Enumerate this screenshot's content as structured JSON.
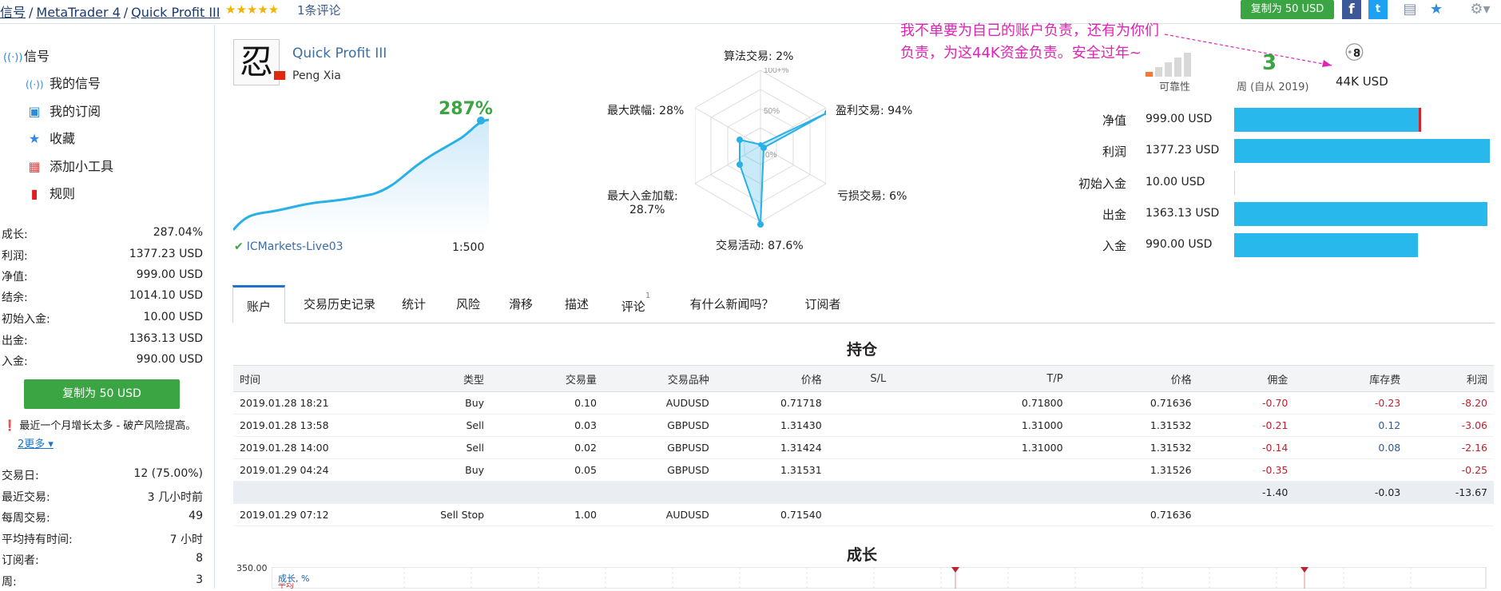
{
  "header": {
    "breadcrumb": [
      "信号",
      "MetaTrader 4",
      "Quick Profit III"
    ],
    "stars": "★★★★★",
    "review_count": "1条评论",
    "copy_button": "复制为 50 USD",
    "icons": [
      "facebook-icon",
      "twitter-icon",
      "document-icon",
      "favorite-star-icon",
      "settings-gear-icon"
    ]
  },
  "sidebar": {
    "section_title": "信号",
    "items": [
      {
        "label": "我的信号",
        "icon": "signal-icon"
      },
      {
        "label": "我的订阅",
        "icon": "subscription-icon"
      },
      {
        "label": "收藏",
        "icon": "star-icon"
      },
      {
        "label": "添加小工具",
        "icon": "widgets-icon"
      },
      {
        "label": "规则",
        "icon": "bookmark-icon"
      }
    ],
    "stats": [
      {
        "k": "成长:",
        "v": "287.04%"
      },
      {
        "k": "利润:",
        "v": "1377.23 USD"
      },
      {
        "k": "净值:",
        "v": "999.00 USD"
      },
      {
        "k": "结余:",
        "v": "1014.10 USD"
      },
      {
        "k": "初始入金:",
        "v": "10.00 USD"
      },
      {
        "k": "出金:",
        "v": "1363.13 USD"
      },
      {
        "k": "入金:",
        "v": "990.00 USD"
      }
    ],
    "copy_button": "复制为 50 USD",
    "warning": "最近一个月增长太多 - 破产风险提高。",
    "more_link": "2更多 ▾",
    "stats2": [
      {
        "k": "交易日:",
        "v": "12 (75.00%)"
      },
      {
        "k": "最近交易:",
        "v": "3 几小时前"
      },
      {
        "k": "每周交易:",
        "v": "49"
      },
      {
        "k": "平均持有时间:",
        "v": "7 小时"
      },
      {
        "k": "订阅者:",
        "v": "8"
      },
      {
        "k": "周:",
        "v": "3"
      }
    ]
  },
  "profile": {
    "name": "Quick Profit III",
    "author": "Peng Xia",
    "avatar_glyph": "忍",
    "growth": "287%",
    "broker": "ICMarkets-Live03",
    "leverage": "1:500"
  },
  "radar": {
    "labels": {
      "algo": "算法交易: 2%",
      "profit_trades": "盈利交易: 94%",
      "loss_trades": "亏损交易: 6%",
      "activity": "交易活动: 87.6%",
      "max_load": "最大入金加载:",
      "max_load_val": "28.7%",
      "max_dd": "最大跌幅: 28%"
    },
    "scale": [
      "100+%",
      "50%",
      "0%"
    ]
  },
  "annotation": "我不单要为自己的账户负责，还有为你们负责，为这44K资金负责。安全过年~",
  "summary": {
    "reliability_label": "可靠性",
    "weeks_value": "3",
    "weeks_label": "周 (自从 2019)",
    "subscribers": "8",
    "funds": "44K USD"
  },
  "bars": [
    {
      "k": "净值",
      "v": "999.00 USD",
      "fraction": 0.72,
      "marker": true
    },
    {
      "k": "利润",
      "v": "1377.23 USD",
      "fraction": 1.0
    },
    {
      "k": "初始入金",
      "v": "10.00 USD",
      "fraction": 0.0
    },
    {
      "k": "出金",
      "v": "1363.13 USD",
      "fraction": 0.99
    },
    {
      "k": "入金",
      "v": "990.00 USD",
      "fraction": 0.72
    }
  ],
  "tabs": [
    "账户",
    "交易历史记录",
    "统计",
    "风险",
    "滑移",
    "描述",
    "评论",
    "有什么新闻吗？",
    "订阅者"
  ],
  "review_badge": "1",
  "positions": {
    "title": "持仓",
    "headers": [
      "时间",
      "类型",
      "交易量",
      "交易品种",
      "价格",
      "S/L",
      "T/P",
      "价格",
      "佣金",
      "库存费",
      "利润"
    ],
    "rows": [
      [
        "2019.01.28 18:21",
        "Buy",
        "0.10",
        "AUDUSD",
        "0.71718",
        "",
        "0.71800",
        "0.71636",
        "-0.70",
        "-0.23",
        "-8.20"
      ],
      [
        "2019.01.28 13:58",
        "Sell",
        "0.03",
        "GBPUSD",
        "1.31430",
        "",
        "1.31000",
        "1.31532",
        "-0.21",
        "0.12",
        "-3.06"
      ],
      [
        "2019.01.28 14:00",
        "Sell",
        "0.02",
        "GBPUSD",
        "1.31424",
        "",
        "1.31000",
        "1.31532",
        "-0.14",
        "0.08",
        "-2.16"
      ],
      [
        "2019.01.29 04:24",
        "Buy",
        "0.05",
        "GBPUSD",
        "1.31531",
        "",
        "",
        "1.31526",
        "-0.35",
        "",
        "-0.25"
      ]
    ],
    "totals": [
      "",
      "",
      "",
      "",
      "",
      "",
      "",
      "",
      "-1.40",
      "-0.03",
      "-13.67"
    ],
    "pending": [
      "2019.01.29 07:12",
      "Sell Stop",
      "1.00",
      "AUDUSD",
      "0.71540",
      "",
      "",
      "0.71636",
      "",
      "",
      ""
    ]
  },
  "growth_section": {
    "title": "成长",
    "y_label": "350.00",
    "series_label": "成长, %",
    "series_label2": "平均"
  },
  "colors": {
    "green": "#3ba544",
    "link": "#1a3a73",
    "bar": "#29b8ec",
    "annotation": "#e023b3",
    "negative": "#c0202f"
  }
}
